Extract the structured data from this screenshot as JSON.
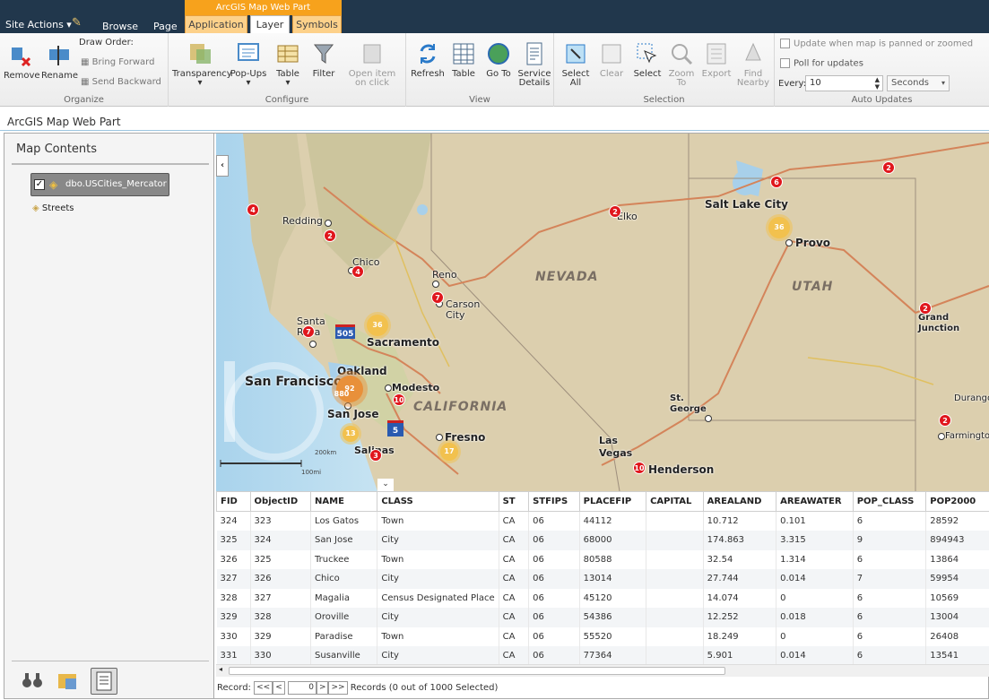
{
  "topnav": {
    "site_actions": "Site Actions",
    "browse": "Browse",
    "page": "Page"
  },
  "ribbon": {
    "context_title": "ArcGIS Map Web Part",
    "tabs": [
      "Application",
      "Layer",
      "Symbols"
    ],
    "organize": {
      "remove": "Remove",
      "rename": "Rename",
      "draw_order": "Draw Order:",
      "bring_forward": "Bring Forward",
      "send_backward": "Send Backward",
      "label": "Organize"
    },
    "configure": {
      "transparency": "Transparency",
      "popups": "Pop-Ups",
      "table": "Table",
      "filter": "Filter",
      "open_item": "Open item on click",
      "label": "Configure"
    },
    "view": {
      "refresh": "Refresh",
      "table": "Table",
      "goto": "Go To",
      "service_details": "Service Details",
      "label": "View"
    },
    "selection": {
      "select_all": "Select All",
      "clear": "Clear",
      "select": "Select",
      "zoom_to": "Zoom To",
      "export": "Export",
      "find_nearby": "Find Nearby",
      "label": "Selection"
    },
    "auto_updates": {
      "update_panned": "Update when map is panned or zoomed",
      "poll": "Poll for updates",
      "every_label": "Every:",
      "every_value": "10",
      "unit": "Seconds",
      "label": "Auto Updates"
    }
  },
  "webpart_title": "ArcGIS Map Web Part",
  "map_contents": {
    "title": "Map Contents",
    "layers": [
      {
        "name": "dbo.USCities_Mercator",
        "checked": true
      },
      {
        "name": "Streets"
      }
    ]
  },
  "map": {
    "states": [
      "NEVADA",
      "UTAH",
      "CALIFORNIA"
    ],
    "cities": [
      "Redding",
      "Chico",
      "Reno",
      "Carson City",
      "Santa Rosa",
      "Sacramento",
      "Oakland",
      "San Francisco",
      "Modesto",
      "San Jose",
      "Salinas",
      "Fresno",
      "Las Vegas",
      "Henderson",
      "St. George",
      "Salt Lake City",
      "Provo",
      "Elko",
      "Grand Junction",
      "Durango",
      "Farmington"
    ],
    "clusters_red": [
      "4",
      "2",
      "4",
      "7",
      "7",
      "2",
      "6",
      "2",
      "10",
      "3",
      "10",
      "2",
      "2"
    ],
    "clusters_yellow": [
      "36",
      "36",
      "13",
      "17"
    ],
    "cluster_orange": [
      "92",
      "880"
    ],
    "highways": [
      "505",
      "5"
    ],
    "scale_text": "200km",
    "scale_text2": "100mi"
  },
  "table": {
    "columns": [
      "FID",
      "ObjectID",
      "NAME",
      "CLASS",
      "ST",
      "STFIPS",
      "PLACEFIP",
      "CAPITAL",
      "AREALAND",
      "AREAWATER",
      "POP_CLASS",
      "POP2000"
    ],
    "rows": [
      [
        "324",
        "323",
        "Los Gatos",
        "Town",
        "CA",
        "06",
        "44112",
        "",
        "10.712",
        "0.101",
        "6",
        "28592"
      ],
      [
        "325",
        "324",
        "San Jose",
        "City",
        "CA",
        "06",
        "68000",
        "",
        "174.863",
        "3.315",
        "9",
        "894943"
      ],
      [
        "326",
        "325",
        "Truckee",
        "Town",
        "CA",
        "06",
        "80588",
        "",
        "32.54",
        "1.314",
        "6",
        "13864"
      ],
      [
        "327",
        "326",
        "Chico",
        "City",
        "CA",
        "06",
        "13014",
        "",
        "27.744",
        "0.014",
        "7",
        "59954"
      ],
      [
        "328",
        "327",
        "Magalia",
        "Census Designated Place",
        "CA",
        "06",
        "45120",
        "",
        "14.074",
        "0",
        "6",
        "10569"
      ],
      [
        "329",
        "328",
        "Oroville",
        "City",
        "CA",
        "06",
        "54386",
        "",
        "12.252",
        "0.018",
        "6",
        "13004"
      ],
      [
        "330",
        "329",
        "Paradise",
        "Town",
        "CA",
        "06",
        "55520",
        "",
        "18.249",
        "0",
        "6",
        "26408"
      ],
      [
        "331",
        "330",
        "Susanville",
        "City",
        "CA",
        "06",
        "77364",
        "",
        "5.901",
        "0.014",
        "6",
        "13541"
      ]
    ]
  },
  "pager": {
    "record_label": "Record:",
    "first": "<<",
    "prev": "<",
    "current": "0",
    "next": ">",
    "last": ">>",
    "status": "Records (0 out of 1000 Selected)"
  }
}
